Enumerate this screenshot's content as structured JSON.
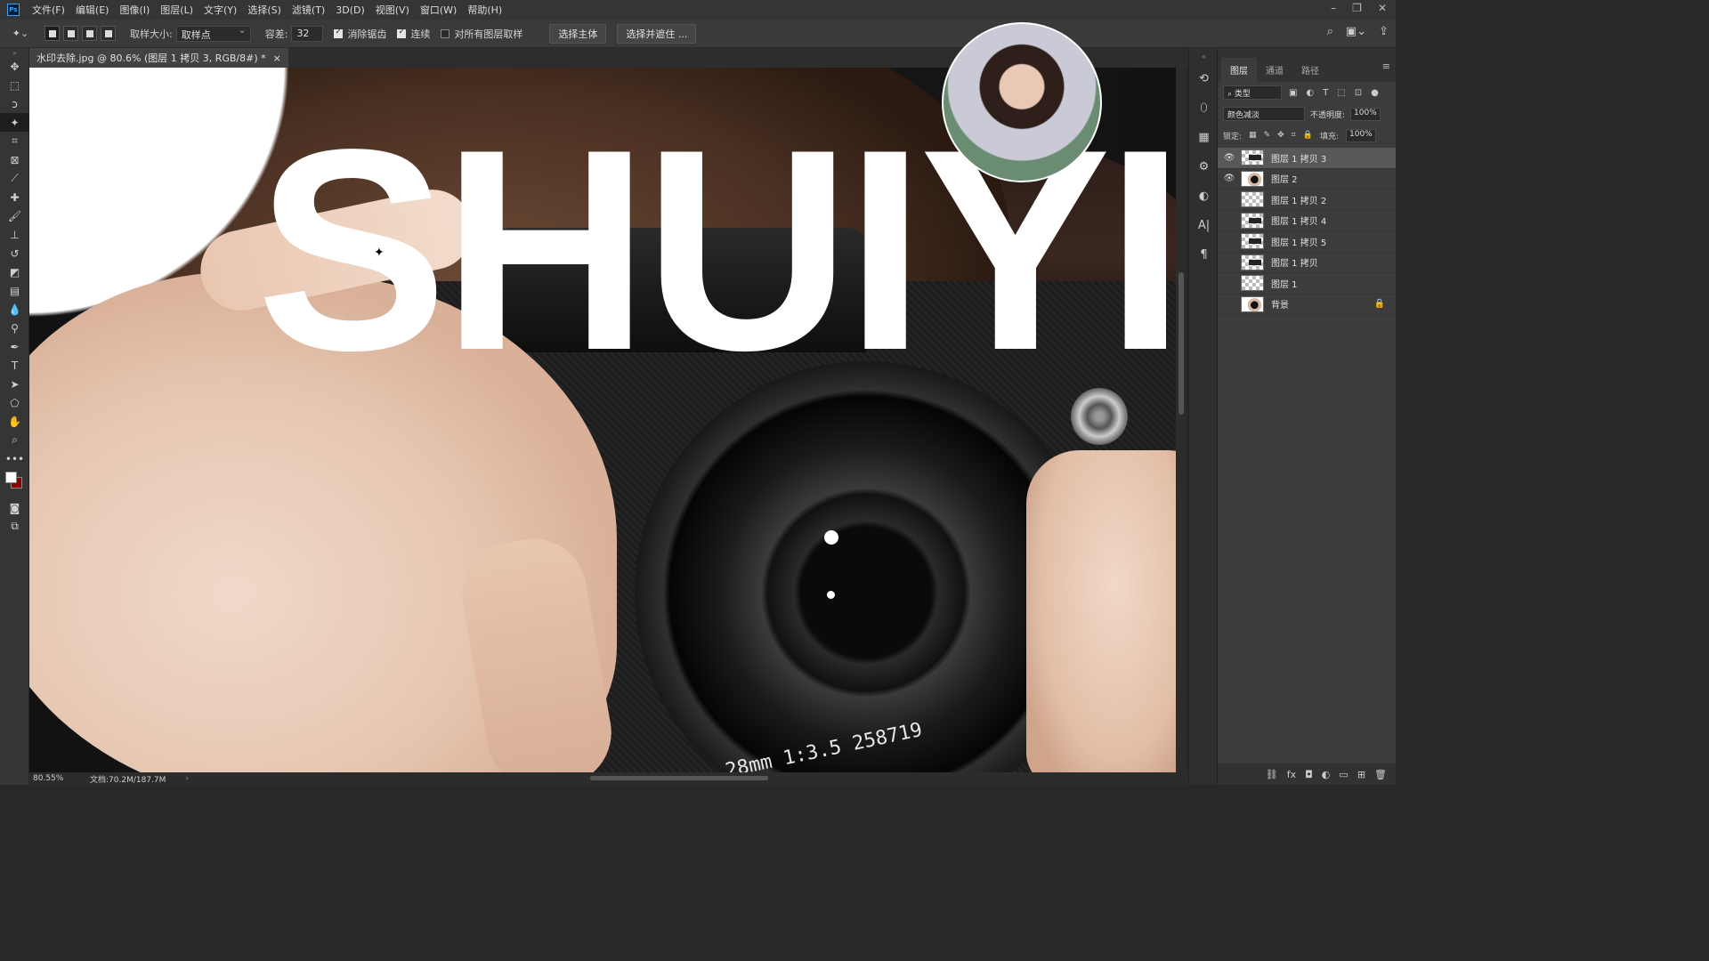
{
  "menubar": {
    "logo": "Ps",
    "items": [
      "文件(F)",
      "编辑(E)",
      "图像(I)",
      "图层(L)",
      "文字(Y)",
      "选择(S)",
      "滤镜(T)",
      "3D(D)",
      "视图(V)",
      "窗口(W)",
      "帮助(H)"
    ]
  },
  "options": {
    "sample_size_label": "取样大小:",
    "sample_size_value": "取样点",
    "tolerance_label": "容差:",
    "tolerance_value": "32",
    "antialias_label": "消除锯齿",
    "contiguous_label": "连续",
    "sample_all_label": "对所有图层取样",
    "select_subject": "选择主体",
    "select_mask": "选择并遮住 ..."
  },
  "document": {
    "tab_title": "水印去除.jpg @ 80.6% (图层 1 拷贝 3, RGB/8#) *",
    "tab_close": "×",
    "headline": "SHUIYI",
    "lens_text": "28mm 1:3.5 258719"
  },
  "status": {
    "zoom": "80.55%",
    "doc_size": "文档:70.2M/187.7M"
  },
  "panel": {
    "tabs": [
      "图层",
      "通道",
      "路径"
    ],
    "filter_value": "类型",
    "blend_mode": "颜色减淡",
    "opacity_label": "不透明度:",
    "opacity_value": "100%",
    "lock_label": "锁定:",
    "fill_label": "填充:",
    "fill_value": "100%",
    "layers": [
      {
        "name": "图层 1 拷贝 3",
        "visible": true,
        "selected": true
      },
      {
        "name": "图层 2",
        "visible": true,
        "selected": false
      },
      {
        "name": "图层 1 拷贝 2",
        "visible": false,
        "selected": false
      },
      {
        "name": "图层 1 拷贝 4",
        "visible": false,
        "selected": false
      },
      {
        "name": "图层 1 拷贝 5",
        "visible": false,
        "selected": false
      },
      {
        "name": "图层 1 拷贝",
        "visible": false,
        "selected": false
      },
      {
        "name": "图层 1",
        "visible": false,
        "selected": false
      },
      {
        "name": "背景",
        "visible": false,
        "selected": false,
        "locked": true
      }
    ]
  },
  "colors": {
    "foreground": "#ffffff",
    "background": "#8b0000"
  }
}
